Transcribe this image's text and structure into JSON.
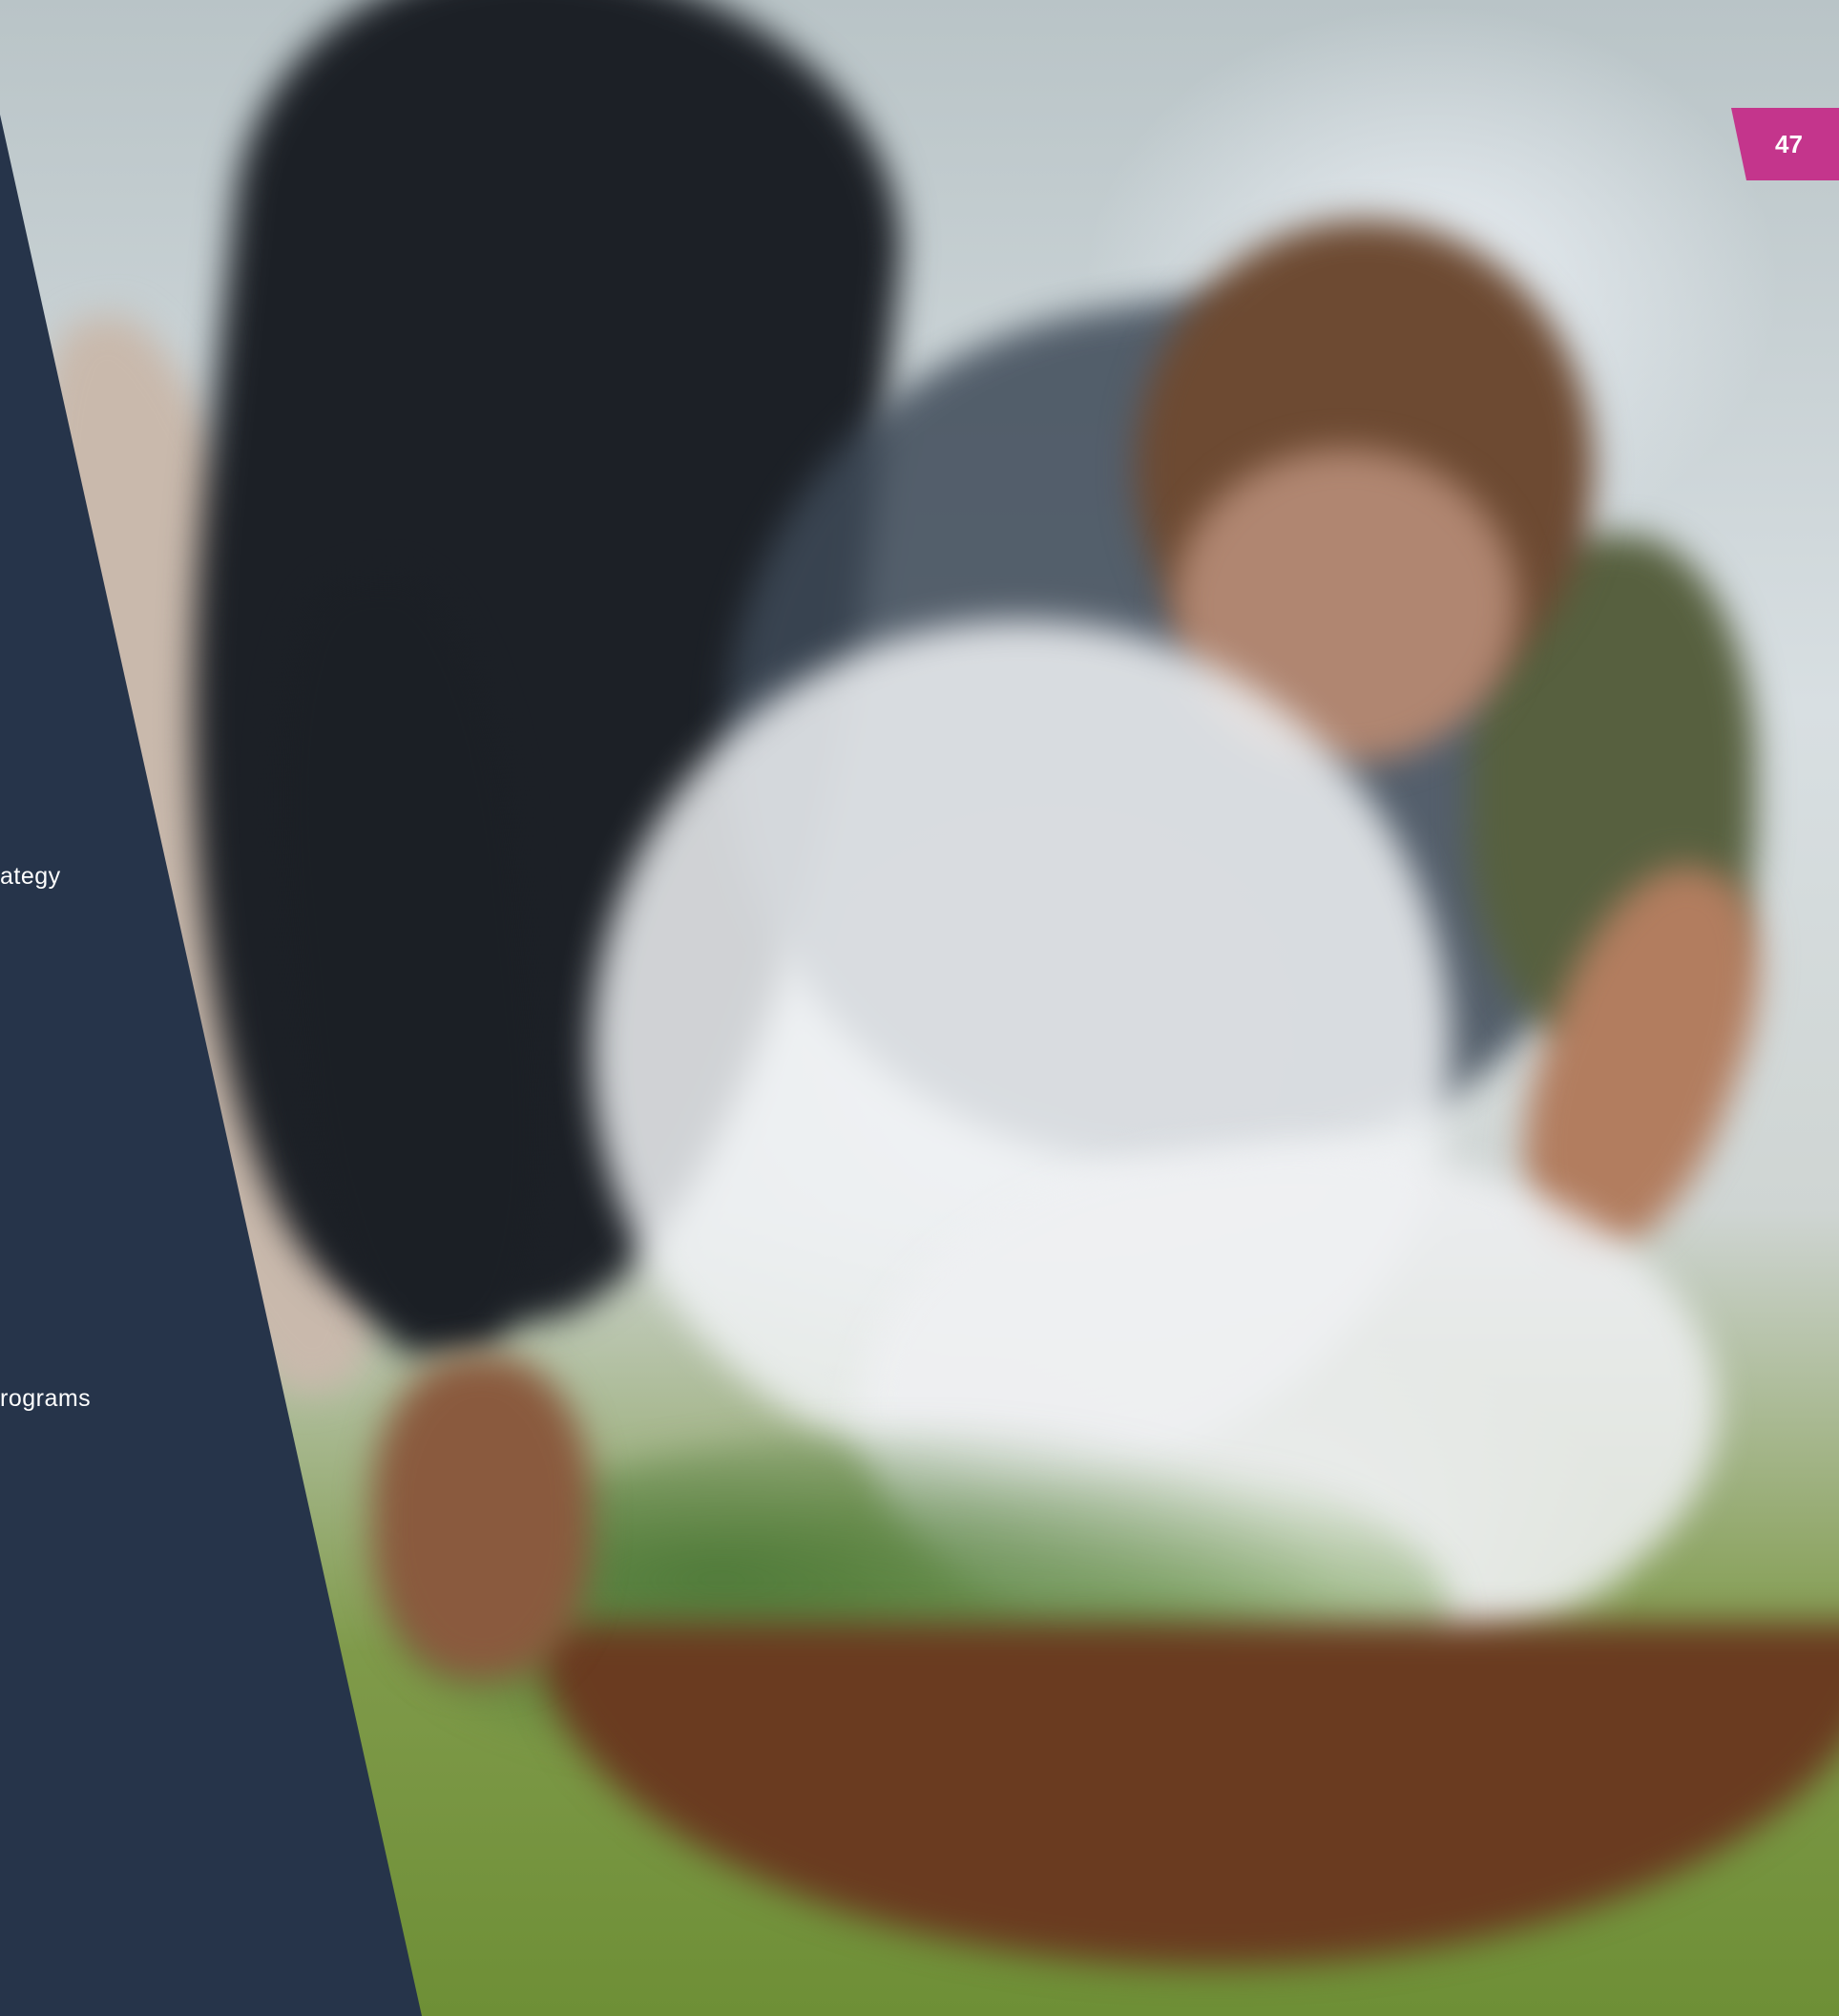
{
  "page": {
    "number": "47"
  },
  "panel": {
    "line_1_fragment": "ategy",
    "line_2_fragment": "rograms"
  },
  "photo": {
    "description_icon": "photo-icon"
  },
  "colors": {
    "navy_panel": "#26344a",
    "page_tab": "#c4358c",
    "text": "#ffffff"
  }
}
